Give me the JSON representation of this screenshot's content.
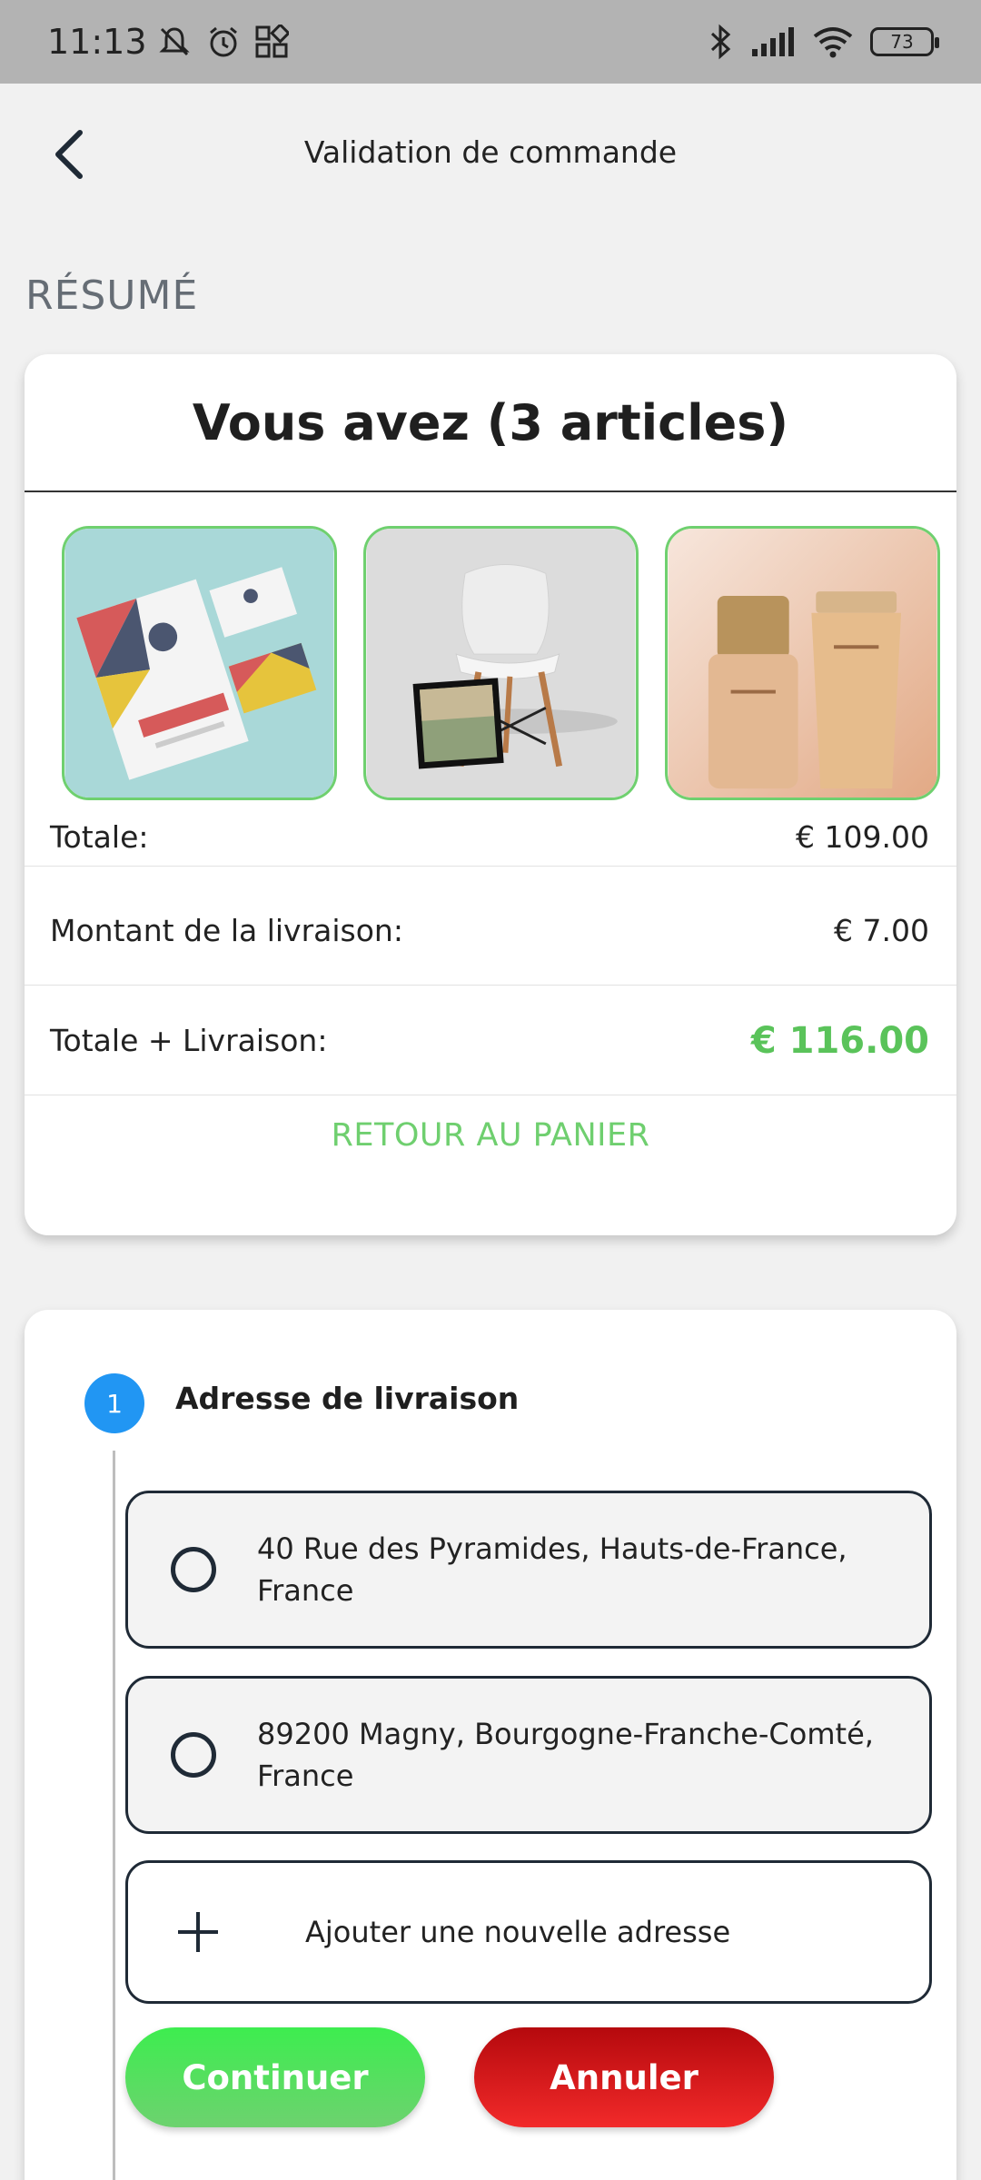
{
  "status_bar": {
    "time": "11:13",
    "battery": "73",
    "icons_left": [
      "mute-icon",
      "alarm-icon",
      "apps-icon"
    ],
    "icons_right": [
      "bluetooth-icon",
      "signal-icon",
      "wifi-icon",
      "battery-icon"
    ]
  },
  "header": {
    "title": "Validation de commande",
    "back_icon": "chevron-left-icon"
  },
  "summary": {
    "section_label": "RÉSUMÉ",
    "title": "Vous avez (3 articles)",
    "products": [
      {
        "name": "stationery-mockup"
      },
      {
        "name": "chair-photo-frame"
      },
      {
        "name": "cosmetics-bottles"
      }
    ],
    "total_label": "Totale:",
    "total_value": "€ 109.00",
    "shipping_label": "Montant de la livraison:",
    "shipping_value": "€ 7.00",
    "grand_total_label": "Totale + Livraison:",
    "grand_total_value": "€ 116.00",
    "back_to_cart": "RETOUR AU PANIER"
  },
  "address_step": {
    "step_number": "1",
    "title": "Adresse de livraison",
    "addresses": [
      "40 Rue des Pyramides, Hauts-de-France, France",
      "89200 Magny, Bourgogne-Franche-Comté, France"
    ],
    "add_new": "Ajouter une nouvelle adresse",
    "continue_label": "Continuer",
    "cancel_label": "Annuler"
  },
  "colors": {
    "accent_green": "#5ac35a",
    "step_blue": "#2196f3",
    "cancel_red": "#e01a1a"
  }
}
